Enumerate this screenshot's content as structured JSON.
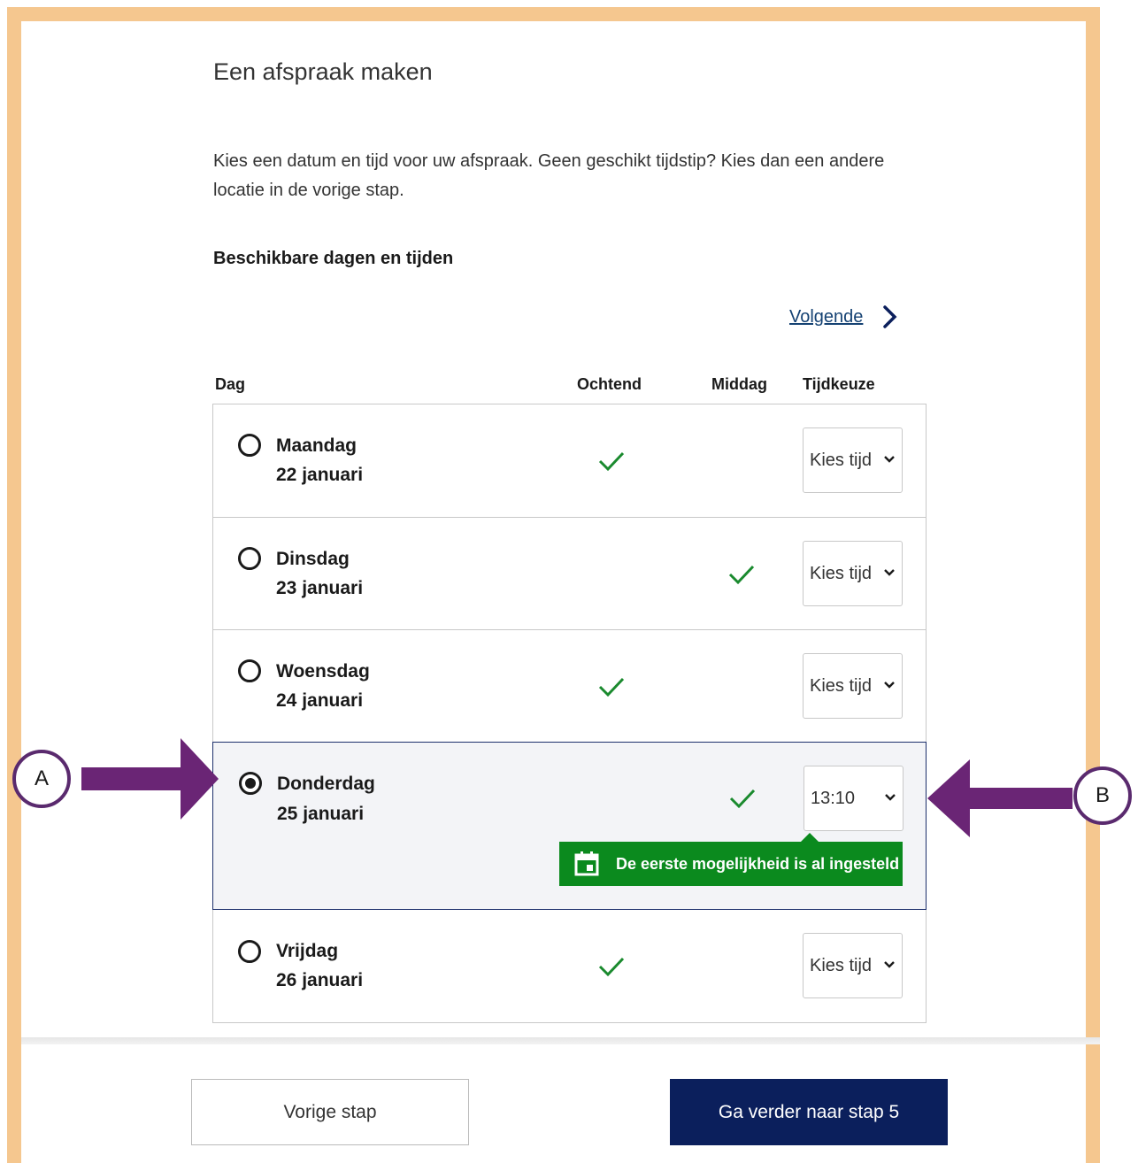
{
  "page": {
    "title": "Een afspraak maken",
    "intro": "Kies een datum en tijd voor uw afspraak. Geen geschikt tijdstip? Kies dan een andere locatie in de vorige stap.",
    "subheading": "Beschikbare dagen en tijden",
    "next_link": "Volgende"
  },
  "table": {
    "headers": {
      "day": "Dag",
      "morning": "Ochtend",
      "afternoon": "Middag",
      "time": "Tijdkeuze"
    },
    "rows": [
      {
        "day": "Maandag",
        "date": "22 januari",
        "morning": true,
        "afternoon": false,
        "time": "Kies tijd",
        "selected": false
      },
      {
        "day": "Dinsdag",
        "date": "23 januari",
        "morning": false,
        "afternoon": true,
        "time": "Kies tijd",
        "selected": false
      },
      {
        "day": "Woensdag",
        "date": "24 januari",
        "morning": true,
        "afternoon": false,
        "time": "Kies tijd",
        "selected": false
      },
      {
        "day": "Donderdag",
        "date": "25 januari",
        "morning": false,
        "afternoon": true,
        "time": "13:10",
        "selected": true
      },
      {
        "day": "Vrijdag",
        "date": "26 januari",
        "morning": true,
        "afternoon": false,
        "time": "Kies tijd",
        "selected": false
      }
    ],
    "notice": "De eerste mogelijkheid is al ingesteld"
  },
  "buttons": {
    "previous": "Vorige stap",
    "continue": "Ga verder naar stap 5"
  },
  "annotations": {
    "a": "A",
    "b": "B"
  },
  "colors": {
    "frame": "#f5c78f",
    "primary": "#0b1f5c",
    "success": "#0b8a1e",
    "link": "#154273",
    "annotation": "#6a2575"
  }
}
